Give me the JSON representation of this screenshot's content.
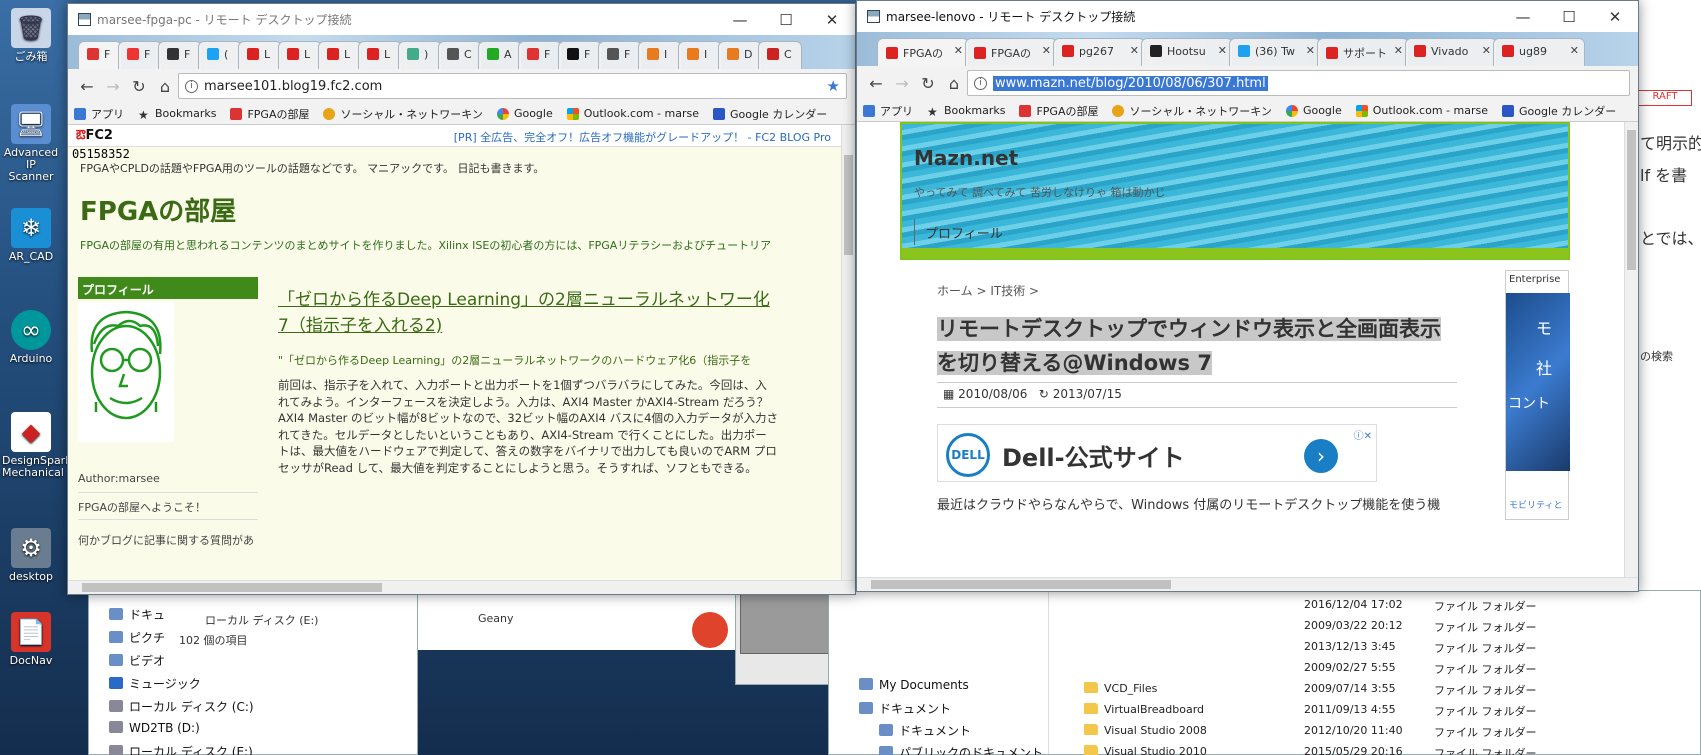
{
  "desktop": {
    "icons": [
      {
        "label": "ごみ箱",
        "glyph": "🗑"
      },
      {
        "label": "Advanced IP Scanner",
        "glyph": "🖥"
      },
      {
        "label": "AR_CAD",
        "glyph": "❄"
      },
      {
        "label": "Arduino",
        "glyph": "∞"
      },
      {
        "label": "DesignSpark Mechanical",
        "glyph": "◆"
      },
      {
        "label": "desktop",
        "glyph": "⚙"
      },
      {
        "label": "DocNav",
        "glyph": "📄"
      }
    ]
  },
  "background_explorer": {
    "left_tree": [
      "ドキュ",
      "ピクチ",
      "ビデオ",
      "ミュージック",
      "ローカル ディスク (C:)",
      "WD2TB (D:)",
      "ローカル ディスク (E:)"
    ],
    "local_disk_e": "ローカル ディスク (E:)",
    "item_count": "102 個の項目",
    "app_name": "Geany",
    "middle_tree": [
      "My Documents",
      "ドキュメント",
      "ドキュメント",
      "パブリックのドキュメント"
    ],
    "files": [
      {
        "name": "",
        "date": "2016/12/04 17:02",
        "type": "ファイル フォルダー"
      },
      {
        "name": "",
        "date": "2009/03/22 20:12",
        "type": "ファイル フォルダー"
      },
      {
        "name": "",
        "date": "2013/12/13 3:45",
        "type": "ファイル フォルダー"
      },
      {
        "name": "",
        "date": "2009/02/27 5:55",
        "type": "ファイル フォルダー"
      },
      {
        "name": "VCD_Files",
        "date": "2009/07/14 3:55",
        "type": "ファイル フォルダー"
      },
      {
        "name": "VirtualBreadboard",
        "date": "2011/09/13 4:55",
        "type": "ファイル フォルダー"
      },
      {
        "name": "Visual Studio 2008",
        "date": "2012/10/20 11:40",
        "type": "ファイル フォルダー"
      },
      {
        "name": "Visual Studio 2010",
        "date": "2015/05/29 20:16",
        "type": "ファイル フォルダー"
      }
    ],
    "right_edge_text": [
      "て明示的",
      "lf を書",
      "とでは、",
      "の検索"
    ],
    "draft_badge": "RAFT"
  },
  "rdp_left": {
    "title": "marsee-fpga-pc - リモート デスクトップ接続",
    "tabs": [
      "F",
      "F",
      "F",
      "(",
      "L",
      "L",
      "L",
      "L",
      ")",
      "C",
      "A",
      "F",
      "F",
      "F",
      "I",
      "I",
      "D",
      "C"
    ],
    "url": "marsee101.blog19.fc2.com",
    "bookmarks": [
      "アプリ",
      "Bookmarks",
      "FPGAの部屋",
      "ソーシャル・ネットワーキン",
      "Google",
      "Outlook.com - marse",
      "Google カレンダー"
    ],
    "fc2": {
      "logo": "FC2",
      "promo": "[PR] 全広告、完全オフ！広告オフ機能がグレードアップ！ - FC2 BLOG Pro",
      "counter": "05158352",
      "tagline": "FPGAやCPLDの話題やFPGA用のツールの話題などです。 マニアックです。 日記も書きます。",
      "blog_title": "FPGAの部屋",
      "blog_desc": "FPGAの部屋の有用と思われるコンテンツのまとめサイトを作りました。Xilinx ISEの初心者の方には、FPGAリテラシーおよびチュートリア",
      "profile_heading": "プロフィール",
      "author": "Author:marsee",
      "welcome": "FPGAの部屋へようこそ！",
      "question": "何かブログに記事に関する質問があ",
      "post_title": "「ゼロから作るDeep Learning」の2層ニューラルネットワー化7（指示子を入れる2)",
      "post_quote": "\"「ゼロから作るDeep Learning」の2層ニューラルネットワークのハードウェア化6（指示子を",
      "post_body": "前回は、指示子を入れて、入力ポートと出力ポートを1個ずつバラバラにしてみた。今回は、入れてみよう。インターフェースを決定しよう。入力は、AXI4 Master かAXI4-Stream だろう？AXI4 Master のビット幅が8ビットなので、32ビット幅のAXI4 バスに4個の入力データが入力されてきた。セルデータとしたいということもあり、AXI4-Stream で行くことにした。出力ポートは、最大値をハードウェアで判定して、答えの数字をバイナリで出力しても良いのでARM プロセッサがRead して、最大値を判定することにしようと思う。そうすれば、ソフともできる。"
    }
  },
  "rdp_right": {
    "title": "marsee-lenovo - リモート デスクトップ接続",
    "tabs": [
      "FPGAの",
      "FPGAの",
      "pg267",
      "Hootsu",
      "(36) Tw",
      "サポート",
      "Vivado",
      "ug89"
    ],
    "url": "www.mazn.net/blog/2010/08/06/307.html",
    "bookmarks": [
      "アプリ",
      "Bookmarks",
      "FPGAの部屋",
      "ソーシャル・ネットワーキン",
      "Google",
      "Outlook.com - marse",
      "Google カレンダー"
    ],
    "mazn": {
      "site_name": "Mazn.net",
      "tagline": "やってみて 調べてみて 苦労しなけりゃ 箱は動かじ",
      "nav_profile": "プロフィール",
      "breadcrumb": "ホーム > IT技術 >",
      "article_title": "リモートデスクトップでウィンドウ表示と全画面表示を切り替える@Windows 7",
      "date_posted": "2010/08/06",
      "date_updated": "2013/07/15",
      "ad_text": "Dell-公式サイト",
      "ad_logo": "DELL",
      "lead": "最近はクラウドやらなんやらで、Windows 付属のリモートデスクトップ機能を使う機",
      "side_ad_heading": "Enterprise",
      "side_ad_chars": [
        "モ",
        "社",
        "コント"
      ],
      "side_ad_foot": "モビリティと"
    }
  },
  "colors": {
    "fc2_green": "#3a6b14",
    "mazn_accent": "#7fc41c",
    "chrome_tab_bg": "#f2f2f2",
    "selection_blue": "#3a78d4"
  }
}
